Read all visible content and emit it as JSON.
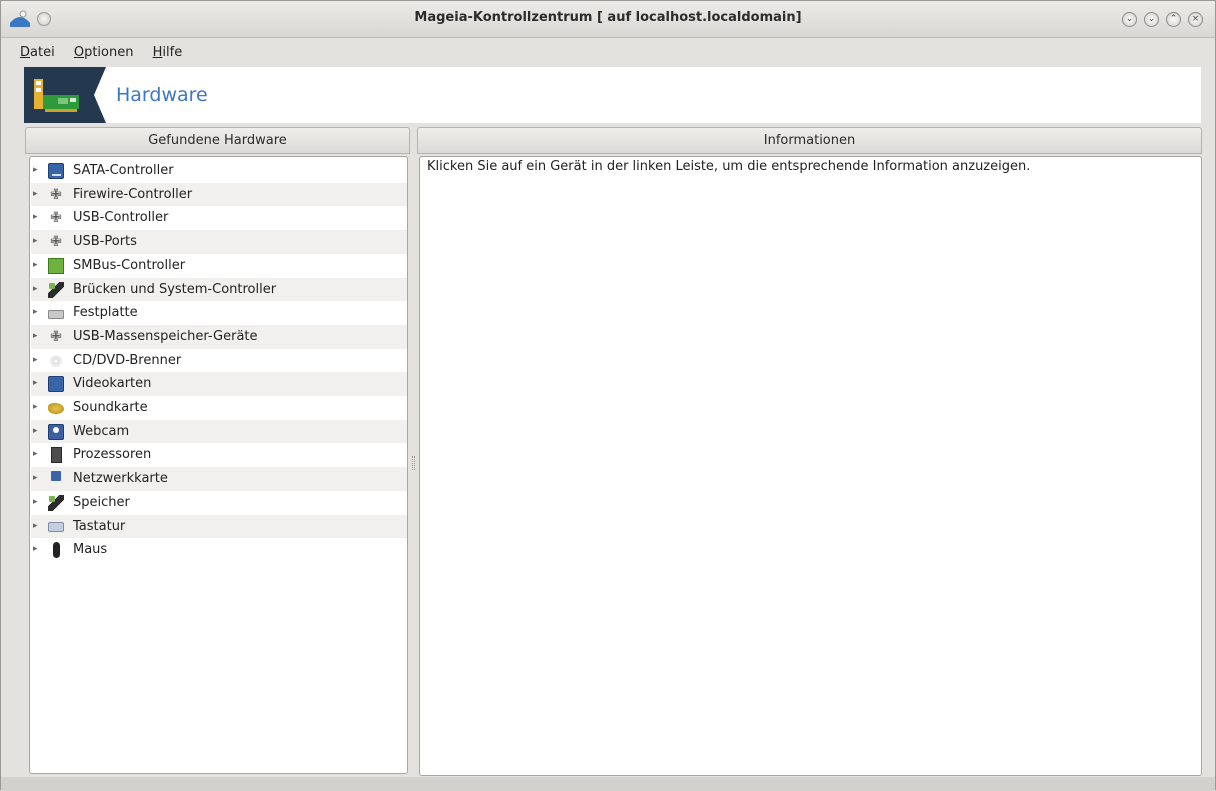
{
  "window": {
    "title": "Mageia-Kontrollzentrum  [ auf localhost.localdomain]",
    "controls": [
      "minimize-icon",
      "shade-icon",
      "maximize-icon",
      "close-icon"
    ]
  },
  "menu": {
    "items": [
      {
        "mnemonic": "D",
        "rest": "atei"
      },
      {
        "mnemonic": "O",
        "rest": "ptionen"
      },
      {
        "mnemonic": "H",
        "rest": "ilfe"
      }
    ]
  },
  "banner": {
    "title": "Hardware"
  },
  "left_pane": {
    "header": "Gefundene Hardware",
    "items": [
      {
        "label": "SATA-Controller",
        "icon": "drive-icon"
      },
      {
        "label": "Firewire-Controller",
        "icon": "plug-icon"
      },
      {
        "label": "USB-Controller",
        "icon": "plug-icon"
      },
      {
        "label": "USB-Ports",
        "icon": "plug-icon"
      },
      {
        "label": "SMBus-Controller",
        "icon": "chip-icon"
      },
      {
        "label": "Brücken und System-Controller",
        "icon": "memory-stick-icon"
      },
      {
        "label": "Festplatte",
        "icon": "harddisk-icon"
      },
      {
        "label": "USB-Massenspeicher-Geräte",
        "icon": "plug-icon"
      },
      {
        "label": "CD/DVD-Brenner",
        "icon": "cd-icon"
      },
      {
        "label": "Videokarten",
        "icon": "monitor-icon"
      },
      {
        "label": "Soundkarte",
        "icon": "speaker-icon"
      },
      {
        "label": "Webcam",
        "icon": "webcam-icon"
      },
      {
        "label": "Prozessoren",
        "icon": "cpu-icon"
      },
      {
        "label": "Netzwerkkarte",
        "icon": "network-icon"
      },
      {
        "label": "Speicher",
        "icon": "memory-stick-icon"
      },
      {
        "label": "Tastatur",
        "icon": "keyboard-icon"
      },
      {
        "label": "Maus",
        "icon": "mouse-icon"
      }
    ]
  },
  "right_pane": {
    "header": "Informationen",
    "text": "Klicken Sie auf ein Gerät in der linken Leiste, um die entsprechende Information anzuzeigen."
  }
}
